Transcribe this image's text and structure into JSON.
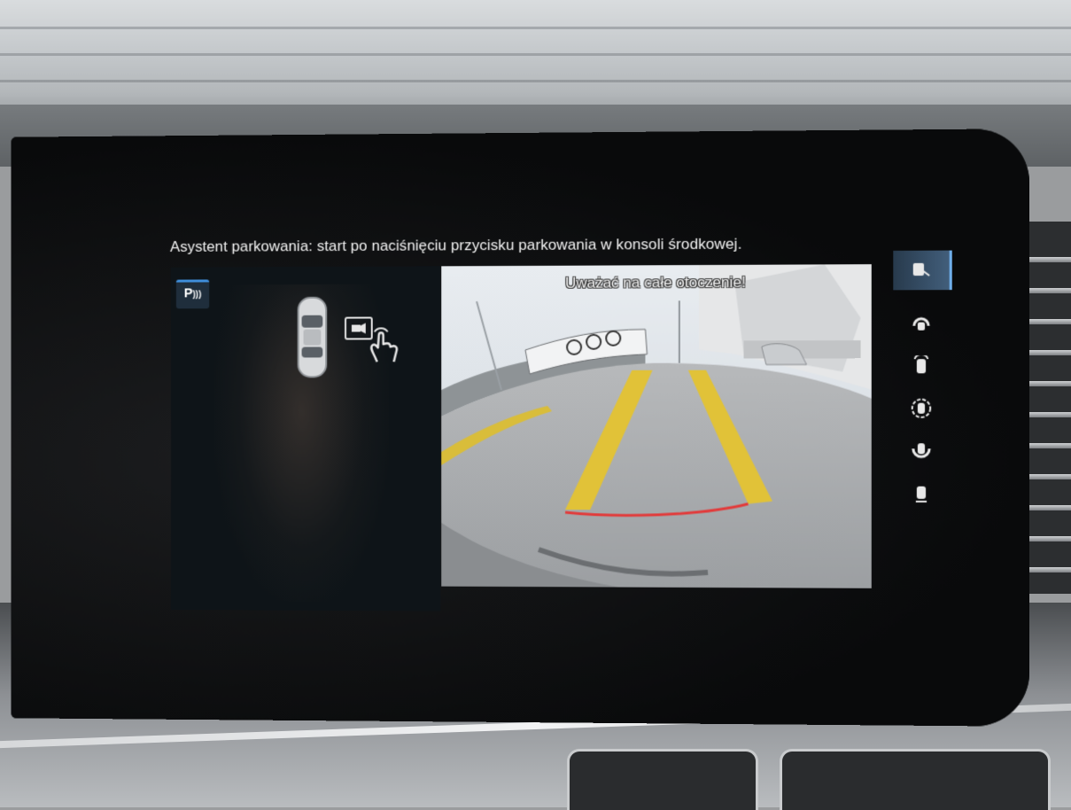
{
  "screen": {
    "banner": "Asystent parkowania: start po naciśnięciu przycisku parkowania w konsoli środkowej."
  },
  "left_panel": {
    "parking_badge": "P",
    "icons": [
      "parking-sensor-icon",
      "car-top-view-icon",
      "camera-tap-icon"
    ]
  },
  "camera": {
    "warning": "Uważać na całe otoczenie!"
  },
  "side_toolbar": {
    "items": [
      {
        "icon": "rear-camera-view-icon",
        "active": true
      },
      {
        "icon": "front-view-icon",
        "active": false
      },
      {
        "icon": "rear-view-icon",
        "active": false
      },
      {
        "icon": "surround-view-icon",
        "active": false
      },
      {
        "icon": "side-view-icon",
        "active": false
      },
      {
        "icon": "trailer-view-icon",
        "active": false
      }
    ]
  },
  "colors": {
    "accent": "#3f8fdc",
    "guide_line": "#e23a3a",
    "lane_paint": "#e2c238"
  }
}
